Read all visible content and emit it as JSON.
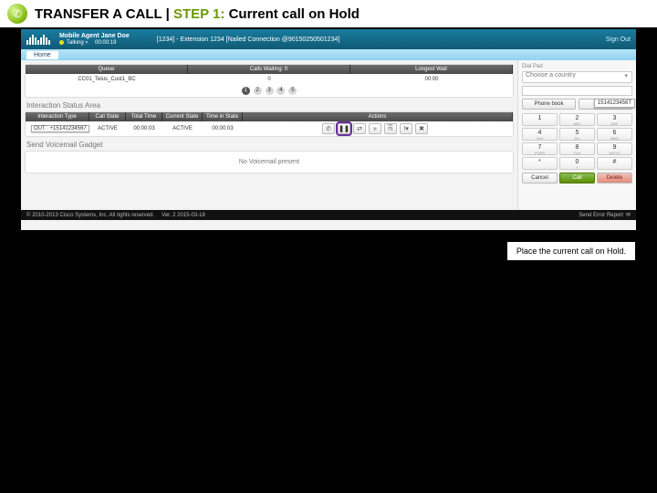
{
  "slide": {
    "title_pre": "TRANSFER A CALL | ",
    "title_step": "STEP 1:",
    "title_post": " Current call on Hold",
    "caption": "Place the current call on Hold."
  },
  "app_header": {
    "agent_name": "Mobile Agent Jane Doe",
    "status": "Talking",
    "timer": "00:00:19",
    "call_info": "[1234] - Extension 1234 [Nailed Connection @90150250501234]",
    "signout": "Sign Out",
    "home_tab": "Home"
  },
  "queues": {
    "labels": {
      "queue": "Queue",
      "waiting": "Calls Waiting: 0",
      "longest": "Longest Wait"
    },
    "row": {
      "name": "CC01_Telus_Cust1_BC",
      "waiting": "0",
      "longest": "00:00"
    },
    "pages": [
      "1",
      "2",
      "3",
      "4",
      "5"
    ]
  },
  "isa_title": "Interaction Status Area",
  "ix": {
    "labels": {
      "type": "Interaction Type",
      "callstate": "Call State",
      "total": "Total Time",
      "current": "Current State",
      "tis": "Time in State",
      "actions": "Actions"
    },
    "row": {
      "type": "OUT : +15141234567",
      "callstate": "ACTIVE",
      "total": "00:00:03",
      "current": "ACTIVE",
      "tis": "00:00:03"
    },
    "action_icons": {
      "phone": "phone-icon",
      "hold": "pause-icon",
      "transfer": "transfer-icon",
      "arrow": "arrow-icon",
      "link": "link-icon",
      "alert": "alert-icon",
      "close": "close-icon"
    }
  },
  "vm": {
    "title": "Send Voicemail Gadget",
    "empty": "No Voicemail present"
  },
  "dialer": {
    "panel_title": "Dial Pad",
    "country_placeholder": "Choose a country",
    "phonebook": "Phone book",
    "manual_label_short": "1514123456T",
    "keypad": [
      {
        "d": "1",
        "s": ""
      },
      {
        "d": "2",
        "s": "ABC"
      },
      {
        "d": "3",
        "s": "DEF"
      },
      {
        "d": "4",
        "s": "GHI"
      },
      {
        "d": "5",
        "s": "JKL"
      },
      {
        "d": "6",
        "s": "MNO"
      },
      {
        "d": "7",
        "s": "PQRS"
      },
      {
        "d": "8",
        "s": "TUV"
      },
      {
        "d": "9",
        "s": "WXYZ"
      },
      {
        "d": "*",
        "s": ""
      },
      {
        "d": "0",
        "s": "+"
      },
      {
        "d": "#",
        "s": ""
      }
    ],
    "cancel": "Cancel",
    "call": "Call",
    "delete": "Delete"
  },
  "footer": {
    "copyright": "© 2010-2013 Cisco Systems, Inc. All rights reserved.",
    "ver": "Ver. 2   2015-03-18",
    "report": "Send Error Report"
  }
}
